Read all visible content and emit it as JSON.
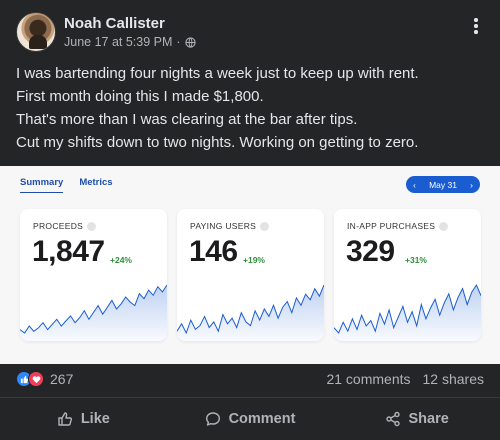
{
  "post": {
    "author": "Noah Callister",
    "timestamp": "June 17 at 5:39 PM",
    "separator": "·",
    "audience_icon": "globe-icon",
    "more_icon": "ellipsis-vertical-icon",
    "lines": [
      "I was bartending four nights a week just to keep up with rent.",
      "First month doing this I made $1,800.",
      "That's more than I was clearing at the bar after tips.",
      "Cut my shifts down to two nights. Working on getting to zero."
    ]
  },
  "dashboard": {
    "tabs": [
      {
        "label": "Summary",
        "active": true
      },
      {
        "label": "Metrics",
        "active": false
      }
    ],
    "date": {
      "prev": "‹",
      "label": "May 31",
      "next": "›"
    },
    "accent": "#1a5dd1",
    "cards": [
      {
        "label": "PROCEEDS",
        "value": "1,847",
        "delta": "+24%",
        "trend": [
          12,
          10,
          14,
          11,
          13,
          16,
          12,
          15,
          18,
          14,
          17,
          20,
          16,
          19,
          23,
          18,
          22,
          26,
          21,
          25,
          29,
          24,
          27,
          31,
          28,
          26,
          33,
          30,
          35,
          32,
          37,
          34,
          38
        ]
      },
      {
        "label": "PAYING USERS",
        "value": "146",
        "delta": "+19%",
        "trend": [
          10,
          14,
          9,
          16,
          11,
          13,
          18,
          12,
          15,
          10,
          19,
          14,
          17,
          12,
          20,
          15,
          13,
          21,
          16,
          22,
          18,
          24,
          17,
          23,
          26,
          20,
          28,
          24,
          30,
          27,
          33,
          29,
          35
        ]
      },
      {
        "label": "IN-APP PURCHASES",
        "value": "329",
        "delta": "+31%",
        "trend": [
          14,
          11,
          17,
          12,
          19,
          13,
          21,
          15,
          18,
          12,
          22,
          16,
          24,
          14,
          20,
          26,
          17,
          23,
          15,
          27,
          19,
          25,
          30,
          21,
          28,
          33,
          24,
          31,
          36,
          27,
          34,
          38,
          32
        ]
      }
    ],
    "delta_color": "#2f8f3a"
  },
  "stats": {
    "reaction_count": "267",
    "comments": "21 comments",
    "shares": "12 shares"
  },
  "actions": {
    "like": "Like",
    "comment": "Comment",
    "share": "Share"
  }
}
